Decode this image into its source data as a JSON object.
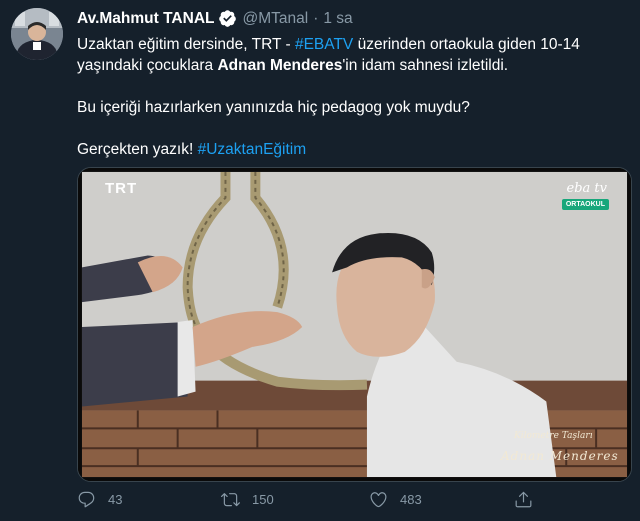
{
  "author": {
    "display_name": "Av.Mahmut TANAL",
    "handle": "@MTanal",
    "separator": "·",
    "time": "1 sa",
    "avatar_icon": "profile-photo",
    "verified_icon": "verified-badge-icon"
  },
  "tweet": {
    "p1_a": "Uzaktan eğitim dersinde, TRT - ",
    "p1_hashtag": "#EBATV",
    "p1_b": " üzerinden ortaokula giden 10-14 yaşındaki çocuklara ",
    "p1_bold": "Adnan Menderes",
    "p1_c": "'in idam sahnesi izletildi.",
    "p2": "Bu içeriği hazırlarken yanınızda hiç pedagog yok muydu?",
    "p3_a": "Gerçekten yazık! ",
    "p3_hashtag": "#UzaktanEğitim"
  },
  "media": {
    "channel_logo": "TRT",
    "eba_logo": "eba tv",
    "eba_badge": "ORTAOKUL",
    "caption_line1": "Kilometre Taşları",
    "caption_line2": "Adnan Menderes"
  },
  "actions": {
    "reply_count": "43",
    "retweet_count": "150",
    "like_count": "483",
    "reply_icon": "reply-icon",
    "retweet_icon": "retweet-icon",
    "like_icon": "heart-icon",
    "share_icon": "share-icon"
  },
  "colors": {
    "background": "#15202b",
    "link": "#1da1f2",
    "muted": "#8899a6",
    "text": "#ffffff"
  }
}
